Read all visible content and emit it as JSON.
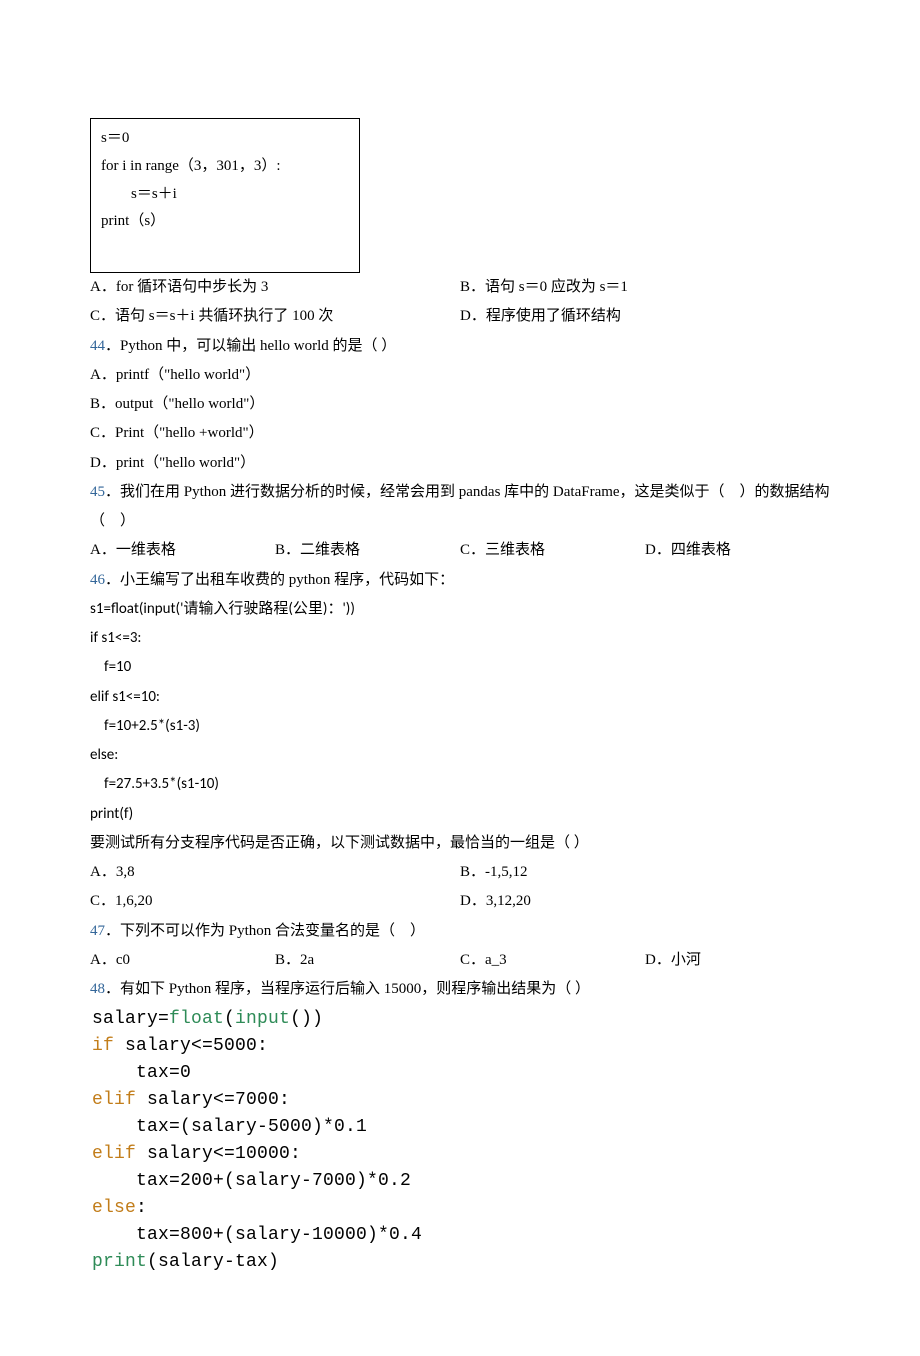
{
  "codebox": {
    "l1": "s＝0",
    "l2": "for i in range（3，301，3）:",
    "l3": "s＝s＋i",
    "l4": "print（s）"
  },
  "q43opts": {
    "A": "A．for 循环语句中步长为 3",
    "B": "B．语句 s＝0 应改为 s＝1",
    "C": "C．语句 s＝s＋i 共循环执行了 100 次",
    "D": "D．程序使用了循环结构"
  },
  "q44": {
    "num": "44",
    "stem": "．Python 中，可以输出 hello world 的是（ ）",
    "A": "A．printf（\"hello world\"）",
    "B": "B．output（\"hello world\"）",
    "C": "C．Print（\"hello +world\"）",
    "D": "D．print（\"hello world\"）"
  },
  "q45": {
    "num": "45",
    "stem": "．我们在用 Python 进行数据分析的时候，经常会用到 pandas 库中的 DataFrame，这是类似于（　）的数据结构 （　）",
    "A": "A．一维表格",
    "B": "B．二维表格",
    "C": "C．三维表格",
    "D": "D．四维表格"
  },
  "q46": {
    "num": "46",
    "stem": "．小王编写了出租车收费的 python 程序，代码如下：",
    "c1": "s1=float(input('请输入行驶路程(公里)：'))",
    "c2": "if s1<=3:",
    "c3": "f=10",
    "c4": "elif s1<=10:",
    "c5": "f=10+2.5*(s1-3)",
    "c6": "else:",
    "c7": "f=27.5+3.5*(s1-10)",
    "c8": "print(f)",
    "ask": "要测试所有分支程序代码是否正确，以下测试数据中，最恰当的一组是（ ）",
    "A": "A．3,8",
    "B": "B．-1,5,12",
    "C": "C．1,6,20",
    "D": "D．3,12,20"
  },
  "q47": {
    "num": "47",
    "stem": "．下列不可以作为 Python 合法变量名的是（　）",
    "A": "A．c0",
    "B": "B．2a",
    "C": "C．a_3",
    "D": "D．小河"
  },
  "q48": {
    "num": "48",
    "stem": "．有如下 Python 程序，当程序运行后输入 15000，则程序输出结果为（ ）",
    "c1a": "salary=",
    "c1b": "float",
    "c1c": "(",
    "c1d": "input",
    "c1e": "())",
    "c2a": "if",
    "c2b": " salary<=5000:",
    "c3": "tax=0",
    "c4a": "elif",
    "c4b": " salary<=7000:",
    "c5": "tax=(salary-5000)*0.1",
    "c6a": "elif",
    "c6b": " salary<=10000:",
    "c7": "tax=200+(salary-7000)*0.2",
    "c8a": "else",
    "c8b": ":",
    "c9": "tax=800+(salary-10000)*0.4",
    "c10a": "print",
    "c10b": "(salary-tax)"
  }
}
